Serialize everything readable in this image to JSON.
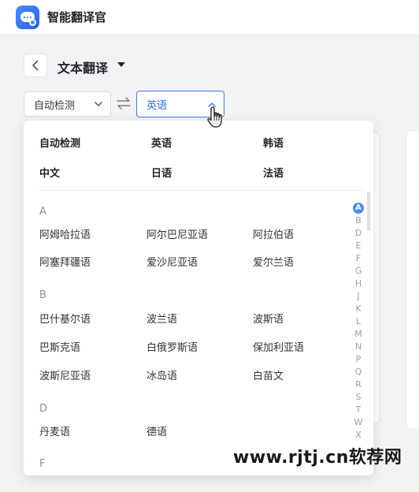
{
  "app": {
    "title": "智能翻译官",
    "logo_icon": "robot-chat-icon",
    "accent": "#3b7cf4"
  },
  "header": {
    "back_icon": "chevron-left-icon",
    "page_title": "文本翻译",
    "title_dropdown_icon": "caret-down-icon"
  },
  "language_bar": {
    "source_value": "自动检测",
    "swap_icon": "swap-arrows-icon",
    "target_value": "英语"
  },
  "dropdown": {
    "common_languages": [
      [
        "自动检测",
        "英语",
        "韩语"
      ],
      [
        "中文",
        "日语",
        "法语"
      ]
    ],
    "groups": [
      {
        "letter": "A",
        "rows": [
          [
            "阿姆哈拉语",
            "阿尔巴尼亚语",
            "阿拉伯语"
          ],
          [
            "阿塞拜疆语",
            "爱沙尼亚语",
            "爱尔兰语"
          ]
        ]
      },
      {
        "letter": "B",
        "rows": [
          [
            "巴什基尔语",
            "波兰语",
            "波斯语"
          ],
          [
            "巴斯克语",
            "白俄罗斯语",
            "保加利亚语"
          ],
          [
            "波斯尼亚语",
            "冰岛语",
            "白苗文"
          ]
        ]
      },
      {
        "letter": "D",
        "rows": [
          [
            "丹麦语",
            "德语"
          ]
        ]
      },
      {
        "letter": "F",
        "rows": []
      }
    ],
    "alphabet_index": [
      "A",
      "B",
      "D",
      "E",
      "F",
      "G",
      "H",
      "J",
      "K",
      "L",
      "M",
      "N",
      "P",
      "Q",
      "R",
      "S",
      "T",
      "W",
      "X"
    ],
    "active_letter": "A"
  },
  "watermark": "www.rjtj.cn软荐网"
}
